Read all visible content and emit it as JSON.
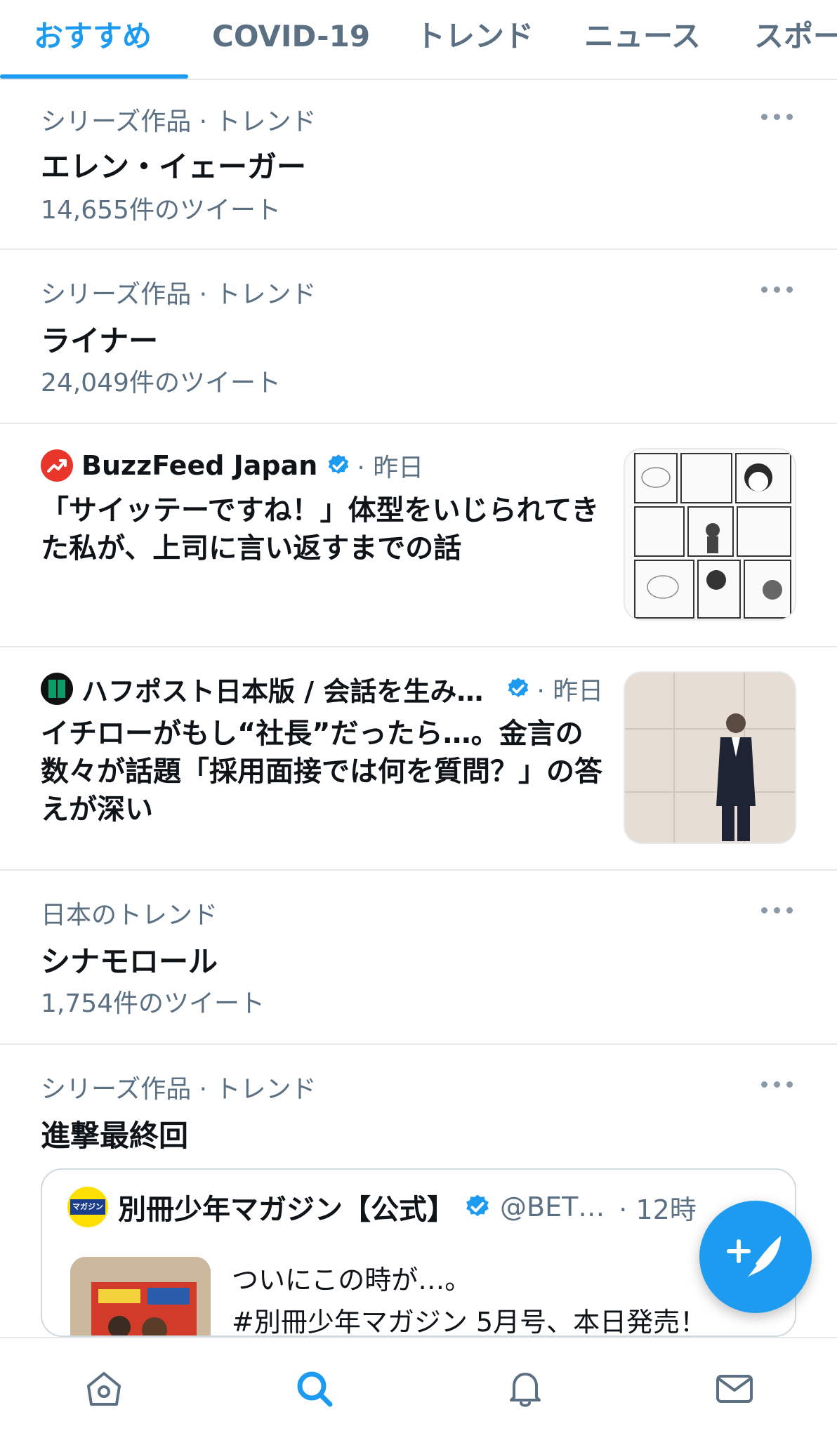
{
  "tabs": [
    {
      "label": "おすすめ",
      "active": true
    },
    {
      "label": "COVID-19"
    },
    {
      "label": "トレンド"
    },
    {
      "label": "ニュース"
    },
    {
      "label": "スポー"
    }
  ],
  "trends": [
    {
      "meta": "シリーズ作品 · トレンド",
      "title": "エレン・イェーガー",
      "count": "14,655件のツイート"
    },
    {
      "meta": "シリーズ作品 · トレンド",
      "title": "ライナー",
      "count": "24,049件のツイート"
    }
  ],
  "news": [
    {
      "source": "BuzzFeed Japan",
      "time": "· 昨日",
      "headline": "「サイッテーですね！」体型をいじられてきた私が、上司に言い返すまでの話",
      "thumbnail_icon": "manga-comic-thumbnail",
      "accent": "#e8362b"
    },
    {
      "source": "ハフポスト日本版 / 会話を生み…",
      "time": "· 昨日",
      "headline": "イチローがもし“社長”だったら…。金言の数々が話題「採用面接では何を質問？」の答えが深い",
      "thumbnail_icon": "man-in-suit-photo-thumbnail",
      "accent": "#0d6a55"
    }
  ],
  "trend3": {
    "meta": "日本のトレンド",
    "title": "シナモロール",
    "count": "1,754件のツイート"
  },
  "trend4": {
    "meta": "シリーズ作品 · トレンド",
    "title": "進撃最終回",
    "embed": {
      "name": "別冊少年マガジン【公式】",
      "handle": "@BET…",
      "time": "· 12時",
      "avatar_text": "マガジン",
      "text_line1": "ついにこの時が…。",
      "text_line2": "#別冊少年マガジン 5月号、本日発売！"
    }
  },
  "bottom_nav": [
    {
      "icon": "home-icon"
    },
    {
      "icon": "search-icon",
      "active": true
    },
    {
      "icon": "bell-icon"
    },
    {
      "icon": "mail-icon"
    }
  ],
  "fab_icon": "compose-tweet-icon",
  "colors": {
    "accent": "#1d9bf0",
    "secondary_text": "#5b7083",
    "divider": "#e6e9ec"
  }
}
